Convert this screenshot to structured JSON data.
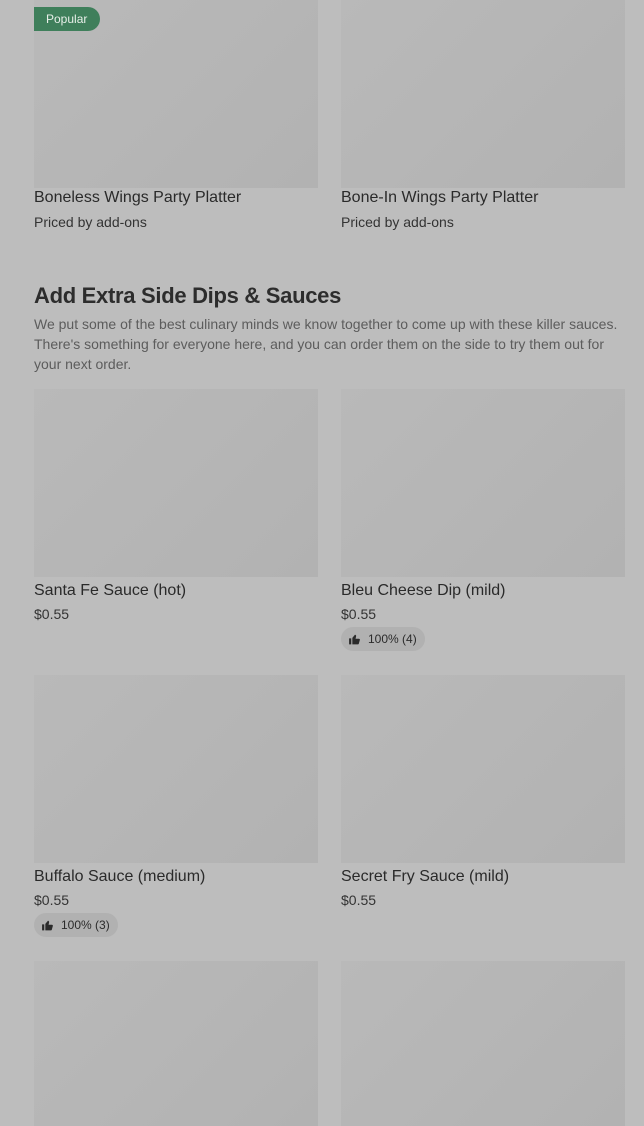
{
  "top_items": [
    {
      "name": "Boneless Wings Party Platter",
      "price": "Priced by add-ons",
      "badge": "Popular"
    },
    {
      "name": "Bone-In Wings Party Platter",
      "price": "Priced by add-ons"
    }
  ],
  "section": {
    "title": "Add Extra Side Dips & Sauces",
    "description": "We put some of the best culinary minds we know together to come up with these killer sauces. There's something for everyone here, and you can order them on the side to try them out for your next order."
  },
  "items": [
    {
      "name": "Santa Fe Sauce (hot)",
      "price": "$0.55"
    },
    {
      "name": "Bleu Cheese Dip (mild)",
      "price": "$0.55",
      "rating": "100% (4)"
    },
    {
      "name": "Buffalo Sauce (medium)",
      "price": "$0.55",
      "rating": "100% (3)"
    },
    {
      "name": "Secret Fry Sauce (mild)",
      "price": "$0.55"
    }
  ],
  "icons": {
    "thumbs_up": "thumbs-up-icon"
  },
  "colors": {
    "popular_badge": "#3f7f5b",
    "overlay_bg": "#bdbdbd"
  }
}
